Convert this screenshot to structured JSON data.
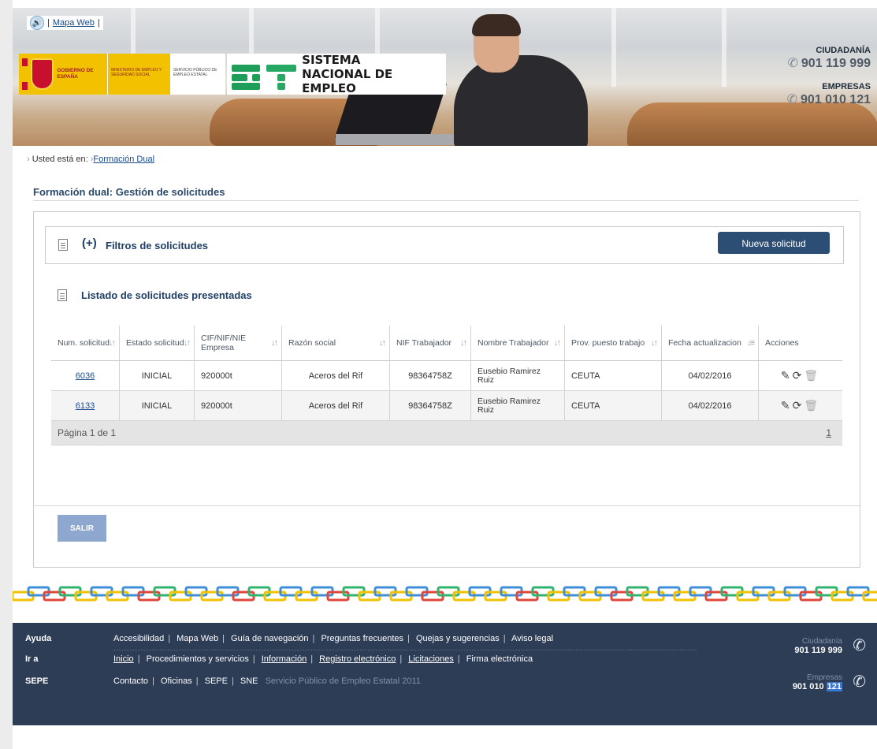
{
  "topbar": {
    "audio_icon": "speaker-icon",
    "map_link": "Mapa Web"
  },
  "header": {
    "gov_logo_text": "GOBIERNO DE ESPAÑA",
    "ministry_text": "MINISTERIO DE EMPLEO Y SEGURIDAD SOCIAL",
    "sepe_text": "SERVICIO PÚBLICO DE EMPLEO ESTATAL",
    "sne_line1": "SISTEMA",
    "sne_line2": "NACIONAL DE EMPLEO",
    "phones": [
      {
        "label": "CIUDADANÍA",
        "number": "901 119 999"
      },
      {
        "label": "EMPRESAS",
        "number": "901 010 121"
      }
    ]
  },
  "breadcrumb": {
    "prefix": "Usted está en:",
    "link": "Formación Dual"
  },
  "page_title": "Formación dual: Gestión de solicitudes",
  "filters": {
    "plus": "(+)",
    "label": "Filtros de solicitudes",
    "new_button": "Nueva solicitud"
  },
  "list": {
    "title": "Listado de solicitudes presentadas",
    "columns": [
      "Num. solicitud",
      "Estado solicitud",
      "CIF/NIF/NIE Empresa",
      "Razón social",
      "NIF Trabajador",
      "Nombre Trabajador",
      "Prov. puesto trabajo",
      "Fecha actualizacion",
      "Acciones"
    ],
    "rows": [
      {
        "num": "6036",
        "estado": "INICIAL",
        "cif": "920000t",
        "razon": "Aceros del Rif",
        "nif": "98364758Z",
        "nombre": "Eusebio Ramirez Ruiz",
        "prov": "CEUTA",
        "fecha": "04/02/2016"
      },
      {
        "num": "6133",
        "estado": "INICIAL",
        "cif": "920000t",
        "razon": "Aceros del Rif",
        "nif": "98364758Z",
        "nombre": "Eusebio Ramirez Ruiz",
        "prov": "CEUTA",
        "fecha": "04/02/2016"
      }
    ],
    "pager_text": "Página 1 de 1",
    "pager_link": "1"
  },
  "exit_button": "SALIR",
  "footer": {
    "rows": [
      {
        "label": "Ayuda",
        "links": [
          "Accesibilidad",
          "Mapa Web",
          "Guía de navegación",
          "Preguntas frecuentes",
          "Quejas y sugerencias",
          "Aviso legal"
        ]
      },
      {
        "label": "Ir a",
        "links": [
          "Inicio",
          "Procedimientos y servicios",
          "Información",
          "Registro electrónico",
          "Licitaciones",
          "Firma electrónica"
        ]
      },
      {
        "label": "SEPE",
        "links": [
          "Contacto",
          "Oficinas",
          "SEPE",
          "SNE"
        ],
        "copy": "Servicio Público de Empleo Estatal 2011"
      }
    ],
    "phones": [
      {
        "label": "Ciudadanía",
        "number": "901 119 999"
      },
      {
        "label": "Empresas",
        "number_prefix": "901 010 ",
        "number_highlight": "121"
      }
    ]
  },
  "colors": {
    "primary_button": "#2d4e74",
    "exit_button": "#8ea7cf",
    "footer_bg": "#2d3d56",
    "title": "#2b4a6b"
  }
}
